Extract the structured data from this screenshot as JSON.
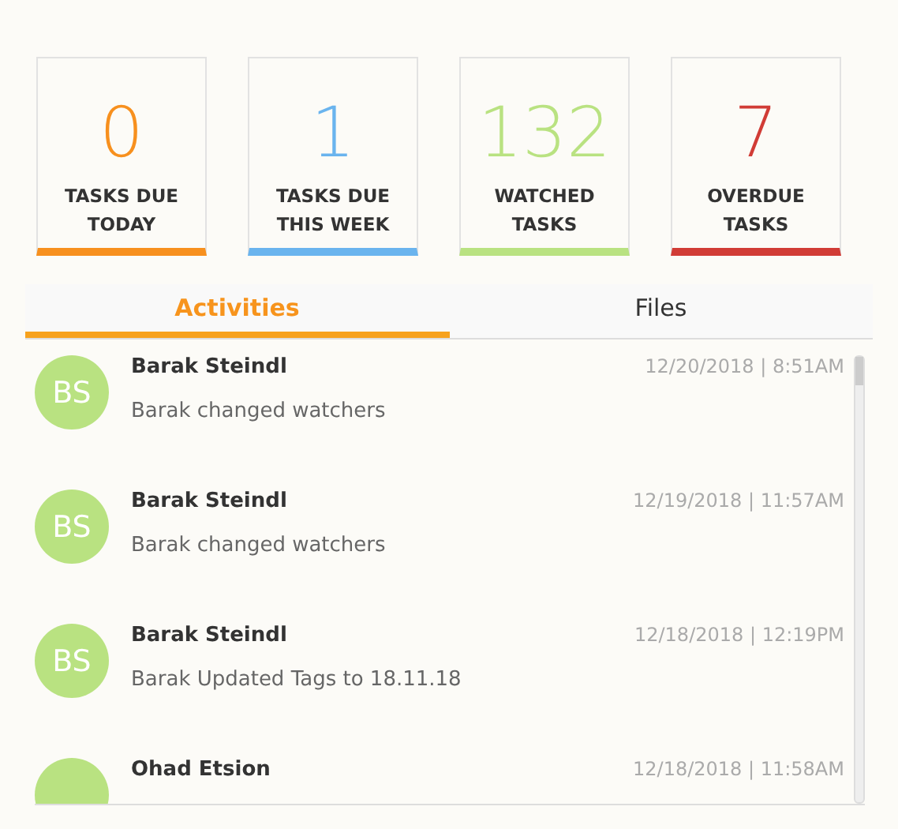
{
  "stats": [
    {
      "value": "0",
      "label": "TASKS DUE TODAY",
      "color": "#f7901e"
    },
    {
      "value": "1",
      "label": "TASKS DUE THIS WEEK",
      "color": "#6ab4ee"
    },
    {
      "value": "132",
      "label": "WATCHED TASKS",
      "color": "#b9e281"
    },
    {
      "value": "7",
      "label": "OVERDUE TASKS",
      "color": "#d13c36"
    }
  ],
  "tabs": [
    {
      "label": "Activities",
      "selected": true
    },
    {
      "label": "Files",
      "selected": false
    }
  ],
  "activities": [
    {
      "initials": "BS",
      "name": "Barak Steindl",
      "time": "12/20/2018 | 8:51AM",
      "text": "Barak changed watchers"
    },
    {
      "initials": "BS",
      "name": "Barak Steindl",
      "time": "12/19/2018 | 11:57AM",
      "text": "Barak changed watchers"
    },
    {
      "initials": "BS",
      "name": "Barak Steindl",
      "time": "12/18/2018 | 12:19PM",
      "text": "Barak Updated Tags to 18.11.18"
    },
    {
      "name": "Ohad Etsion",
      "time": "12/18/2018 | 11:58AM"
    }
  ]
}
